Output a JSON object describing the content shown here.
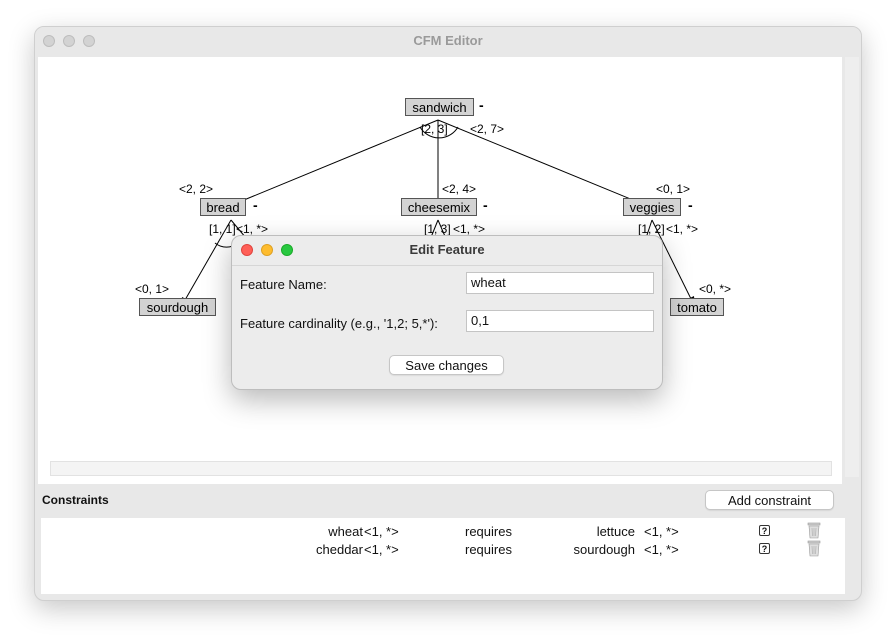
{
  "window": {
    "title": "CFM Editor"
  },
  "tree": {
    "root": {
      "name": "sandwich",
      "dash": "-",
      "group": "[2, 3]",
      "card": "<2, 7>"
    },
    "children": [
      {
        "name": "bread",
        "dash": "-",
        "card": "<2, 2>",
        "group": "[1, 1]",
        "group_card": "<1, *>"
      },
      {
        "name": "cheesemix",
        "dash": "-",
        "card": "<2, 4>",
        "group": "[1, 3]",
        "group_card": "<1, *>"
      },
      {
        "name": "veggies",
        "dash": "-",
        "card": "<0, 1>",
        "group": "[1, 2]",
        "group_card": "<1, *>"
      }
    ],
    "grandchildren": [
      {
        "name": "sourdough",
        "card": "<0, 1>"
      },
      {
        "name": "tomato",
        "card": "<0, *>"
      }
    ]
  },
  "constraints": {
    "header": "Constraints",
    "add_label": "Add constraint",
    "rows": [
      {
        "left": "wheat",
        "left_card": "<1, *>",
        "relation": "requires",
        "right": "lettuce",
        "right_card": "<1, *>",
        "help": "?"
      },
      {
        "left": "cheddar",
        "left_card": "<1, *>",
        "relation": "requires",
        "right": "sourdough",
        "right_card": "<1, *>",
        "help": "?"
      }
    ]
  },
  "dialog": {
    "title": "Edit Feature",
    "name_label": "Feature Name:",
    "name_value": "wheat",
    "card_label": "Feature cardinality (e.g., '1,2; 5,*'):",
    "card_value": "0,1",
    "save_label": "Save changes"
  },
  "colors": {
    "node_fill": "#d3d3d3",
    "close": "#ff5f57",
    "minimize": "#febc2e",
    "zoom": "#28c840"
  }
}
